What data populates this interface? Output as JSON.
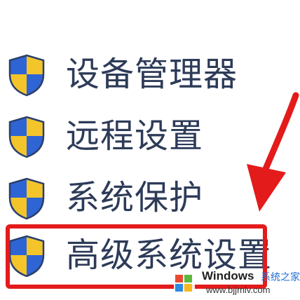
{
  "menu": {
    "items": [
      {
        "label": "设备管理器",
        "icon": "uac-shield-icon"
      },
      {
        "label": "远程设置",
        "icon": "uac-shield-icon"
      },
      {
        "label": "系统保护",
        "icon": "uac-shield-icon"
      },
      {
        "label": "高级系统设置",
        "icon": "uac-shield-icon"
      }
    ],
    "highlighted_item": "高级系统设置"
  },
  "annotation": {
    "color": "#e31b1b"
  },
  "watermark": {
    "title": "Windows",
    "subtitle": "系统之家",
    "url": "www.bjjmlv.com"
  },
  "colors": {
    "label_text": "#2d3b58",
    "shield_blue": "#2f64d4",
    "shield_yellow": "#f3c52b"
  }
}
